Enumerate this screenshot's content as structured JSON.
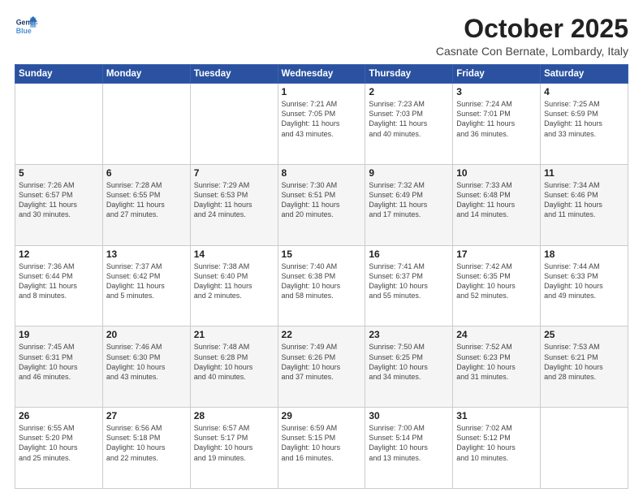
{
  "header": {
    "logo_line1": "General",
    "logo_line2": "Blue",
    "month": "October 2025",
    "location": "Casnate Con Bernate, Lombardy, Italy"
  },
  "weekdays": [
    "Sunday",
    "Monday",
    "Tuesday",
    "Wednesday",
    "Thursday",
    "Friday",
    "Saturday"
  ],
  "weeks": [
    [
      {
        "day": "",
        "info": ""
      },
      {
        "day": "",
        "info": ""
      },
      {
        "day": "",
        "info": ""
      },
      {
        "day": "1",
        "info": "Sunrise: 7:21 AM\nSunset: 7:05 PM\nDaylight: 11 hours\nand 43 minutes."
      },
      {
        "day": "2",
        "info": "Sunrise: 7:23 AM\nSunset: 7:03 PM\nDaylight: 11 hours\nand 40 minutes."
      },
      {
        "day": "3",
        "info": "Sunrise: 7:24 AM\nSunset: 7:01 PM\nDaylight: 11 hours\nand 36 minutes."
      },
      {
        "day": "4",
        "info": "Sunrise: 7:25 AM\nSunset: 6:59 PM\nDaylight: 11 hours\nand 33 minutes."
      }
    ],
    [
      {
        "day": "5",
        "info": "Sunrise: 7:26 AM\nSunset: 6:57 PM\nDaylight: 11 hours\nand 30 minutes."
      },
      {
        "day": "6",
        "info": "Sunrise: 7:28 AM\nSunset: 6:55 PM\nDaylight: 11 hours\nand 27 minutes."
      },
      {
        "day": "7",
        "info": "Sunrise: 7:29 AM\nSunset: 6:53 PM\nDaylight: 11 hours\nand 24 minutes."
      },
      {
        "day": "8",
        "info": "Sunrise: 7:30 AM\nSunset: 6:51 PM\nDaylight: 11 hours\nand 20 minutes."
      },
      {
        "day": "9",
        "info": "Sunrise: 7:32 AM\nSunset: 6:49 PM\nDaylight: 11 hours\nand 17 minutes."
      },
      {
        "day": "10",
        "info": "Sunrise: 7:33 AM\nSunset: 6:48 PM\nDaylight: 11 hours\nand 14 minutes."
      },
      {
        "day": "11",
        "info": "Sunrise: 7:34 AM\nSunset: 6:46 PM\nDaylight: 11 hours\nand 11 minutes."
      }
    ],
    [
      {
        "day": "12",
        "info": "Sunrise: 7:36 AM\nSunset: 6:44 PM\nDaylight: 11 hours\nand 8 minutes."
      },
      {
        "day": "13",
        "info": "Sunrise: 7:37 AM\nSunset: 6:42 PM\nDaylight: 11 hours\nand 5 minutes."
      },
      {
        "day": "14",
        "info": "Sunrise: 7:38 AM\nSunset: 6:40 PM\nDaylight: 11 hours\nand 2 minutes."
      },
      {
        "day": "15",
        "info": "Sunrise: 7:40 AM\nSunset: 6:38 PM\nDaylight: 10 hours\nand 58 minutes."
      },
      {
        "day": "16",
        "info": "Sunrise: 7:41 AM\nSunset: 6:37 PM\nDaylight: 10 hours\nand 55 minutes."
      },
      {
        "day": "17",
        "info": "Sunrise: 7:42 AM\nSunset: 6:35 PM\nDaylight: 10 hours\nand 52 minutes."
      },
      {
        "day": "18",
        "info": "Sunrise: 7:44 AM\nSunset: 6:33 PM\nDaylight: 10 hours\nand 49 minutes."
      }
    ],
    [
      {
        "day": "19",
        "info": "Sunrise: 7:45 AM\nSunset: 6:31 PM\nDaylight: 10 hours\nand 46 minutes."
      },
      {
        "day": "20",
        "info": "Sunrise: 7:46 AM\nSunset: 6:30 PM\nDaylight: 10 hours\nand 43 minutes."
      },
      {
        "day": "21",
        "info": "Sunrise: 7:48 AM\nSunset: 6:28 PM\nDaylight: 10 hours\nand 40 minutes."
      },
      {
        "day": "22",
        "info": "Sunrise: 7:49 AM\nSunset: 6:26 PM\nDaylight: 10 hours\nand 37 minutes."
      },
      {
        "day": "23",
        "info": "Sunrise: 7:50 AM\nSunset: 6:25 PM\nDaylight: 10 hours\nand 34 minutes."
      },
      {
        "day": "24",
        "info": "Sunrise: 7:52 AM\nSunset: 6:23 PM\nDaylight: 10 hours\nand 31 minutes."
      },
      {
        "day": "25",
        "info": "Sunrise: 7:53 AM\nSunset: 6:21 PM\nDaylight: 10 hours\nand 28 minutes."
      }
    ],
    [
      {
        "day": "26",
        "info": "Sunrise: 6:55 AM\nSunset: 5:20 PM\nDaylight: 10 hours\nand 25 minutes."
      },
      {
        "day": "27",
        "info": "Sunrise: 6:56 AM\nSunset: 5:18 PM\nDaylight: 10 hours\nand 22 minutes."
      },
      {
        "day": "28",
        "info": "Sunrise: 6:57 AM\nSunset: 5:17 PM\nDaylight: 10 hours\nand 19 minutes."
      },
      {
        "day": "29",
        "info": "Sunrise: 6:59 AM\nSunset: 5:15 PM\nDaylight: 10 hours\nand 16 minutes."
      },
      {
        "day": "30",
        "info": "Sunrise: 7:00 AM\nSunset: 5:14 PM\nDaylight: 10 hours\nand 13 minutes."
      },
      {
        "day": "31",
        "info": "Sunrise: 7:02 AM\nSunset: 5:12 PM\nDaylight: 10 hours\nand 10 minutes."
      },
      {
        "day": "",
        "info": ""
      }
    ]
  ]
}
